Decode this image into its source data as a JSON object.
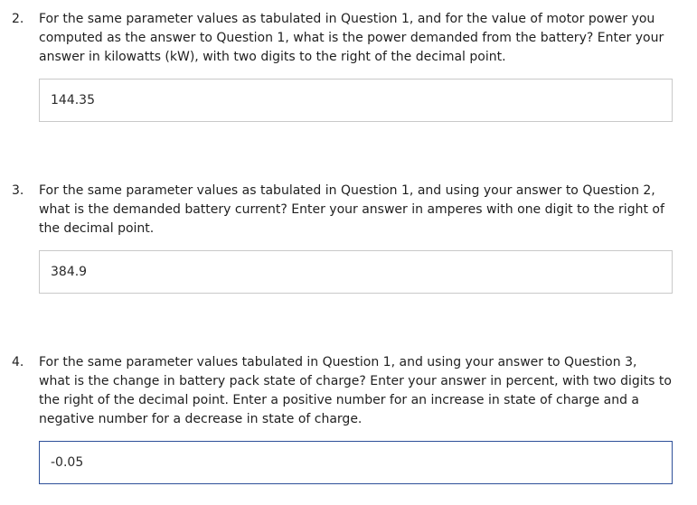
{
  "questions": [
    {
      "number": "2.",
      "prompt": "For the same parameter values as tabulated in Question 1, and for the value of motor power you computed as the answer to Question 1, what is the power demanded from the battery? Enter your answer in kilowatts (kW), with two digits to the right of the decimal point.",
      "answer": "144.35"
    },
    {
      "number": "3.",
      "prompt": "For the same parameter values as tabulated in Question 1, and using your answer to Question 2, what is the demanded battery current? Enter your answer in amperes with one digit to the right of the decimal point.",
      "answer": "384.9"
    },
    {
      "number": "4.",
      "prompt": "For the same parameter values tabulated in Question 1, and using your answer to Question 3, what is the change in battery pack state of charge? Enter your answer in percent, with two digits to the right of the decimal point. Enter a positive number for an increase in state of charge and a negative number for a decrease in state of charge.",
      "answer": "-0.05"
    }
  ],
  "colors": {
    "input_border": "#c9c9c9",
    "input_border_focused": "#2d4f99",
    "text": "#1f1f1f"
  }
}
